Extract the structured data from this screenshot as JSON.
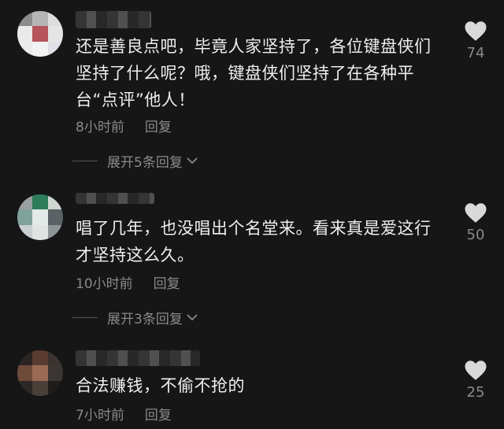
{
  "comments": [
    {
      "text": "还是善良点吧，毕竟人家坚持了，各位键盘侠们坚持了什么呢？哦，键盘侠们坚持了在各种平台“点评”他人！",
      "time": "8小时前",
      "reply": "回复",
      "likes": "74",
      "expand": "展开5条回复"
    },
    {
      "text": "唱了几年，也没唱出个名堂来。看来真是爱这行才坚持这么久。",
      "time": "10小时前",
      "reply": "回复",
      "likes": "50",
      "expand": "展开3条回复"
    },
    {
      "text": "合法赚钱，不偷不抢的",
      "time": "7小时前",
      "reply": "回复",
      "likes": "25"
    }
  ],
  "icons": {
    "like": "heart-icon",
    "expand": "chevron-down-icon"
  },
  "colors": {
    "background": "#161616",
    "text": "#efefef",
    "secondary": "#8a8a8a",
    "heart": "#d9d9d9"
  }
}
